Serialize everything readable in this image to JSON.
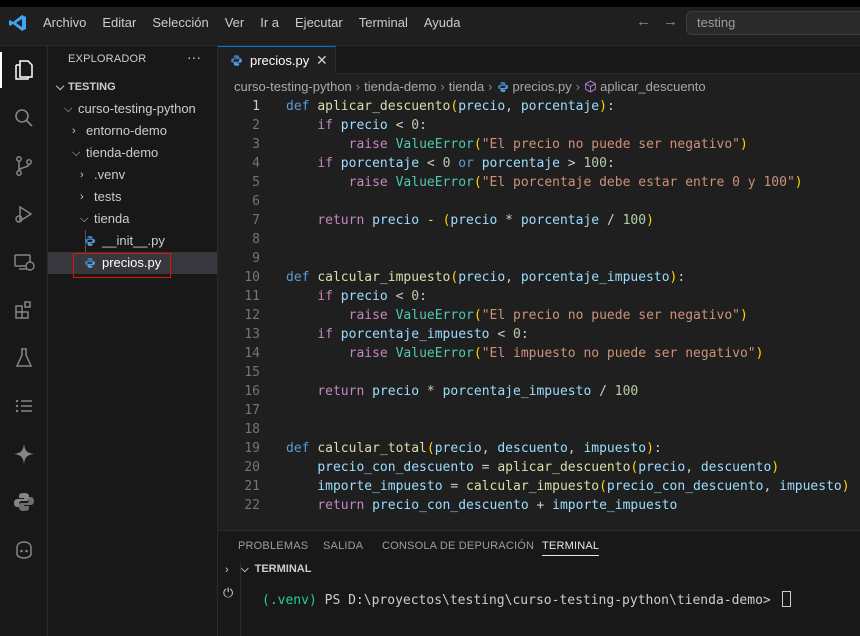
{
  "menu": [
    "Archivo",
    "Editar",
    "Selección",
    "Ver",
    "Ir a",
    "Ejecutar",
    "Terminal",
    "Ayuda"
  ],
  "search": {
    "value": "testing"
  },
  "explorer": {
    "title": "EXPLORADOR",
    "more": "···",
    "items": [
      {
        "label": "TESTING",
        "depth": 0,
        "chevron": "down"
      },
      {
        "label": "curso-testing-python",
        "depth": 1,
        "chevron": "down"
      },
      {
        "label": "entorno-demo",
        "depth": 2,
        "chevron": "right"
      },
      {
        "label": "tienda-demo",
        "depth": 2,
        "chevron": "down"
      },
      {
        "label": ".venv",
        "depth": 3,
        "chevron": "right"
      },
      {
        "label": "tests",
        "depth": 3,
        "chevron": "right"
      },
      {
        "label": "tienda",
        "depth": 3,
        "chevron": "down"
      },
      {
        "label": "__init__.py",
        "depth": 4,
        "chevron": ""
      },
      {
        "label": "precios.py",
        "depth": 4,
        "chevron": "",
        "selected": true
      }
    ]
  },
  "tab": {
    "label": "precios.py",
    "close": "✕"
  },
  "breadcrumb": [
    "curso-testing-python",
    "tienda-demo",
    "tienda",
    "precios.py",
    "aplicar_descuento"
  ],
  "code": {
    "current_line": 1,
    "lines": [
      "def aplicar_descuento(precio, porcentaje):",
      "    if precio < 0:",
      "        raise ValueError(\"El precio no puede ser negativo\")",
      "    if porcentaje < 0 or porcentaje > 100:",
      "        raise ValueError(\"El porcentaje debe estar entre 0 y 100\")",
      "",
      "    return precio - (precio * porcentaje / 100)",
      "",
      "",
      "def calcular_impuesto(precio, porcentaje_impuesto):",
      "    if precio < 0:",
      "        raise ValueError(\"El precio no puede ser negativo\")",
      "    if porcentaje_impuesto < 0:",
      "        raise ValueError(\"El impuesto no puede ser negativo\")",
      "",
      "    return precio * porcentaje_impuesto / 100",
      "",
      "",
      "def calcular_total(precio, descuento, impuesto):",
      "    precio_con_descuento = aplicar_descuento(precio, descuento)",
      "    importe_impuesto = calcular_impuesto(precio_con_descuento, impuesto)",
      "    return precio_con_descuento + importe_impuesto"
    ]
  },
  "panel": {
    "tabs": [
      "PROBLEMAS",
      "SALIDA",
      "CONSOLA DE DEPURACIÓN",
      "TERMINAL"
    ],
    "active_tab": "TERMINAL",
    "terminal_header": "TERMINAL",
    "venv": "(.venv)",
    "prompt": " PS D:\\proyectos\\testing\\curso-testing-python\\tienda-demo> "
  },
  "colors": {
    "accent": "#0078d4",
    "keyword": "#569cd6",
    "function": "#dcdcaa",
    "param": "#9cdcfe",
    "string": "#ce9178",
    "number": "#b5cea8",
    "class": "#4ec9b0",
    "selection_box": "#e51400"
  }
}
